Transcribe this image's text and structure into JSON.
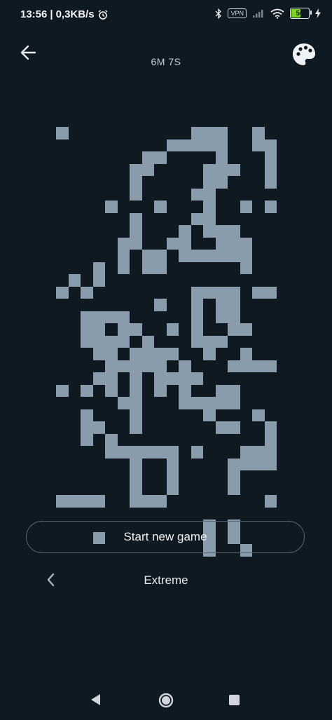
{
  "status_bar": {
    "time": "13:56",
    "separator": "|",
    "network_speed": "0,3KB/s",
    "vpn": "VPN",
    "battery": "56",
    "battery_level": 0.56,
    "icons": [
      "alarm-icon",
      "bluetooth-icon",
      "signal-icon",
      "wifi-icon",
      "charging-icon"
    ]
  },
  "header": {
    "timer": "6M 7S",
    "back_icon": "arrow-left-icon",
    "palette_icon": "palette-icon"
  },
  "board": {
    "columns": 18,
    "rows": 30,
    "cell_color": "#8a9bab",
    "background": "#0f1922",
    "filled_rows": [
      [
        0,
        11,
        12,
        13,
        16
      ],
      [
        9,
        10,
        11,
        12,
        13,
        16,
        17
      ],
      [
        7,
        8,
        13,
        17
      ],
      [
        6,
        7,
        12,
        13,
        14,
        17
      ],
      [
        6,
        12,
        13,
        17
      ],
      [
        6,
        11,
        12
      ],
      [
        4,
        8,
        12,
        15,
        17
      ],
      [
        6,
        11,
        12
      ],
      [
        6,
        10,
        12,
        13,
        14
      ],
      [
        5,
        6,
        9,
        10,
        13,
        14,
        15
      ],
      [
        5,
        7,
        8,
        10,
        11,
        12,
        13,
        14,
        15
      ],
      [
        3,
        5,
        7,
        8,
        15
      ],
      [
        1,
        3
      ],
      [
        0,
        2,
        11,
        12,
        13,
        14,
        16,
        17
      ],
      [
        8,
        11,
        13,
        14
      ],
      [
        2,
        3,
        4,
        5,
        11,
        13,
        14
      ],
      [
        2,
        3,
        5,
        6,
        9,
        11,
        14,
        15
      ],
      [
        2,
        3,
        4,
        5,
        7,
        11,
        12,
        13
      ],
      [
        3,
        4,
        6,
        7,
        8,
        9,
        12,
        15
      ],
      [
        4,
        5,
        6,
        7,
        8,
        10,
        14,
        15,
        16,
        17
      ],
      [
        3,
        4,
        6,
        8,
        9,
        10,
        11
      ],
      [
        0,
        2,
        4,
        6,
        8,
        10,
        13,
        14
      ],
      [
        5,
        6,
        10,
        11,
        12,
        13,
        14
      ],
      [
        2,
        6,
        12,
        16
      ],
      [
        2,
        3,
        6,
        13,
        14,
        17
      ],
      [
        2,
        4,
        17
      ],
      [
        4,
        5,
        6,
        7,
        8,
        9,
        11,
        15,
        16,
        17
      ],
      [
        6,
        9,
        14,
        15,
        16,
        17
      ],
      [
        6,
        9,
        14
      ],
      [
        6,
        9,
        14
      ],
      [
        0,
        1,
        2,
        3,
        6,
        7,
        8,
        17
      ],
      [],
      [
        12,
        14
      ],
      [
        3,
        12,
        14
      ],
      [
        12,
        15
      ]
    ]
  },
  "actions": {
    "start_new_game": "Start new game",
    "difficulty": "Extreme",
    "difficulty_prev_icon": "chevron-left-icon"
  },
  "nav": {
    "back_icon": "nav-back-icon",
    "home_icon": "nav-home-icon",
    "recents_icon": "nav-recents-icon"
  }
}
